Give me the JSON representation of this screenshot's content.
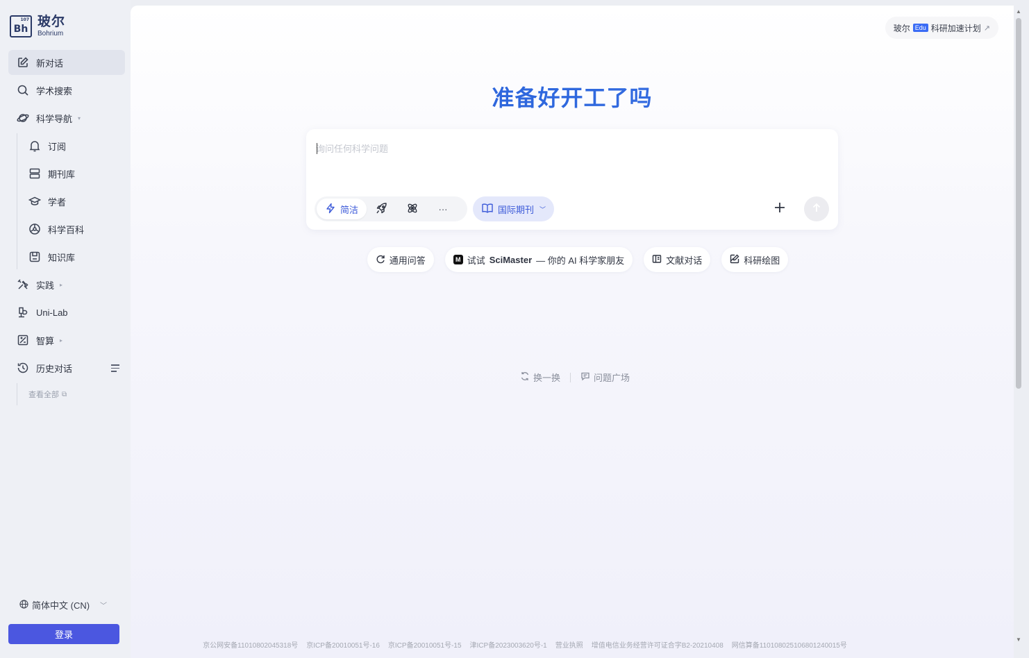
{
  "brand": {
    "name_cn": "玻尔",
    "name_en": "Bohrium",
    "mark_text": "Bh",
    "mark_num": "107"
  },
  "sidebar": {
    "items": [
      {
        "label": "新对话",
        "icon": "edit-icon"
      },
      {
        "label": "学术搜索",
        "icon": "search-icon"
      },
      {
        "label": "科学导航",
        "icon": "planet-icon"
      }
    ],
    "subitems": [
      {
        "label": "订阅",
        "icon": "bell-icon"
      },
      {
        "label": "期刊库",
        "icon": "database-icon"
      },
      {
        "label": "学者",
        "icon": "graduation-cap-icon"
      },
      {
        "label": "科学百科",
        "icon": "wiki-icon"
      },
      {
        "label": "知识库",
        "icon": "save-icon"
      }
    ],
    "items2": [
      {
        "label": "实践",
        "icon": "tools-icon"
      },
      {
        "label": "Uni-Lab",
        "icon": "lab-icon"
      },
      {
        "label": "智算",
        "icon": "compute-icon"
      },
      {
        "label": "历史对话",
        "icon": "history-icon"
      }
    ],
    "view_all": "查看全部",
    "language": "简体中文 (CN)",
    "login": "登录"
  },
  "main": {
    "edu_prefix": "玻尔",
    "edu_badge": "Edu",
    "edu_suffix": "科研加速计划",
    "headline": "准备好开工了吗",
    "composer": {
      "placeholder": "询问任何科学问题",
      "mode_active": "简洁",
      "journal": "国际期刊",
      "more": "···"
    },
    "chips": {
      "qa": "通用问答",
      "scimaster_pre": "试试",
      "scimaster_name": "SciMaster",
      "scimaster_post": "— 你的 AI 科学家朋友",
      "literature": "文献对话",
      "drawing": "科研绘图"
    },
    "refresh": "换一换",
    "plaza": "问题广场"
  },
  "footer": [
    "京公网安备11010802045318号",
    "京ICP备20010051号-16",
    "京ICP备20010051号-15",
    "津ICP备2023003620号-1",
    "营业执照",
    "增值电信业务经营许可证合字B2-20210408",
    "网信算备110108025106801240015号"
  ],
  "colors": {
    "accent": "#3d5bd9",
    "login": "#4b57e0",
    "headline": "#2f62d8"
  }
}
